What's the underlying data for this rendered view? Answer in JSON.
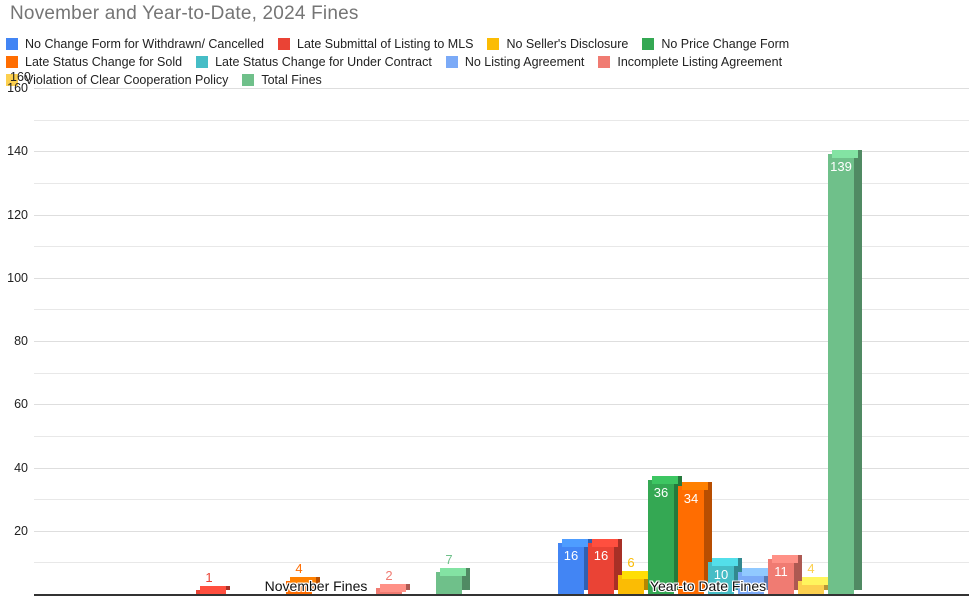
{
  "chart_data": {
    "type": "bar",
    "title": "November and Year-to-Date, 2024 Fines",
    "xlabel": "",
    "ylabel": "",
    "ylim": [
      0,
      160
    ],
    "yticks": [
      0,
      10,
      20,
      30,
      40,
      50,
      60,
      70,
      80,
      90,
      100,
      110,
      120,
      130,
      140,
      150,
      160
    ],
    "ytick_labels": [
      "",
      "",
      "20",
      "",
      "40",
      "",
      "60",
      "",
      "80",
      "",
      "100",
      "",
      "120",
      "",
      "140",
      "",
      "160"
    ],
    "grid": true,
    "legend_position": "top",
    "categories": [
      "November Fines",
      "Year-to Date Fines"
    ],
    "series": [
      {
        "name": "No Change Form for Withdrawn/ Cancelled",
        "color": "#4285F4",
        "values": [
          0,
          16
        ]
      },
      {
        "name": "Late Submittal of Listing to MLS",
        "color": "#EA4335",
        "values": [
          1,
          16
        ]
      },
      {
        "name": "No Seller's Disclosure",
        "color": "#FBBC04",
        "values": [
          0,
          6
        ]
      },
      {
        "name": "No Price Change Form",
        "color": "#34A853",
        "values": [
          0,
          36
        ]
      },
      {
        "name": "Late Status Change for Sold",
        "color": "#FF6D01",
        "values": [
          4,
          34
        ]
      },
      {
        "name": "Late Status Change for Under Contract",
        "color": "#46BDC6",
        "values": [
          0,
          10
        ]
      },
      {
        "name": "No Listing Agreement",
        "color": "#7BAAF7",
        "values": [
          0,
          7
        ]
      },
      {
        "name": "Incomplete Listing Agreement",
        "color": "#F07B72",
        "values": [
          2,
          11
        ]
      },
      {
        "name": "Violation of Clear Cooperation Policy",
        "color": "#FCD04F",
        "values": [
          0,
          4
        ]
      },
      {
        "name": "Total Fines",
        "color": "#6FC08A",
        "values": [
          7,
          139
        ]
      }
    ],
    "data_labels": {
      "november": [
        "",
        "1",
        "",
        "",
        "4",
        "",
        "",
        "2",
        "",
        "7"
      ],
      "year_to_date": [
        "16",
        "16",
        "6",
        "36",
        "34",
        "10",
        "",
        "11",
        "4",
        "139"
      ]
    },
    "overflow_tick": "160"
  }
}
